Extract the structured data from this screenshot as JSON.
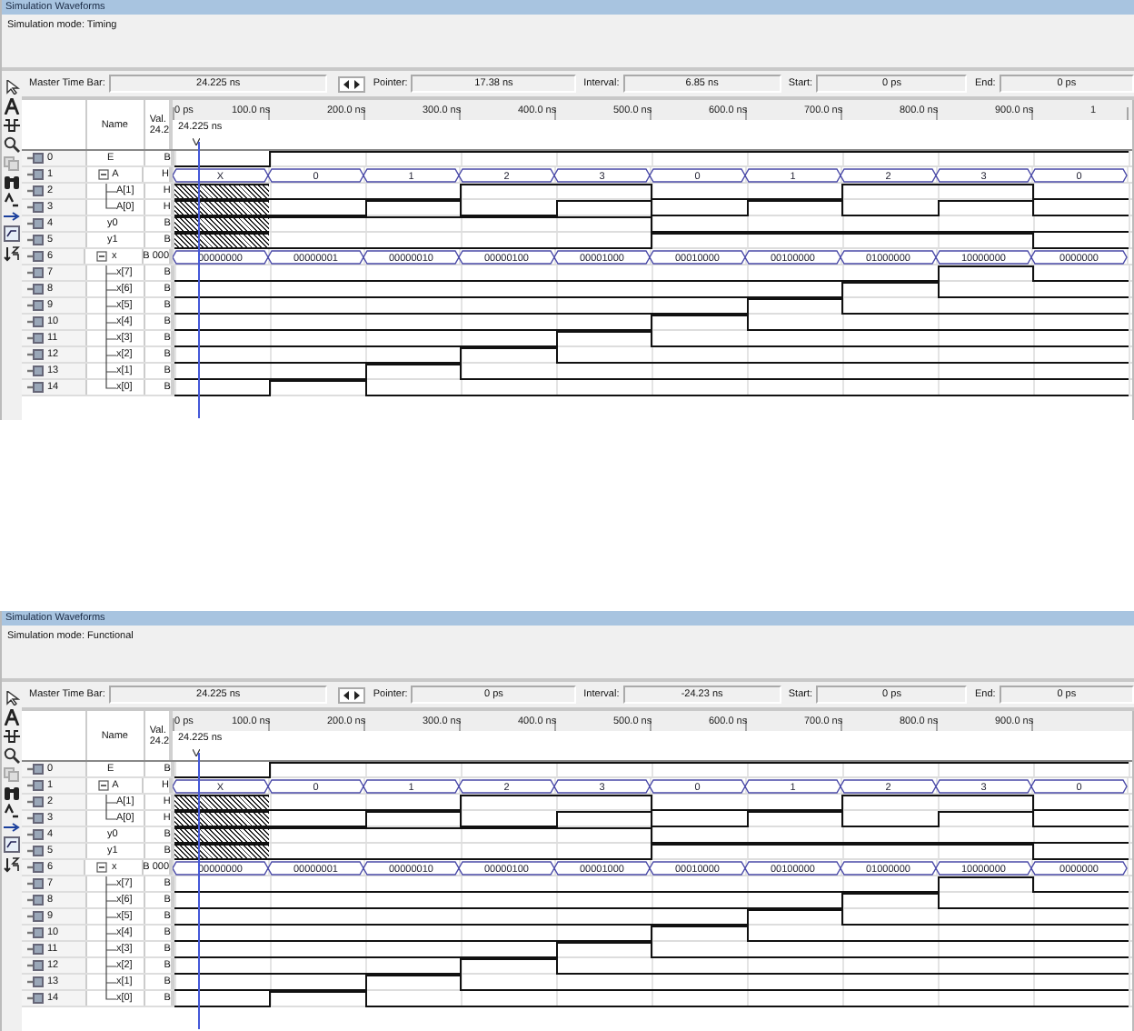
{
  "panels": [
    {
      "title": "Simulation Waveforms",
      "mode": "Simulation mode: Timing",
      "master_time_bar": {
        "label": "Master Time Bar:",
        "value": "24.225 ns"
      },
      "pointer": {
        "label": "Pointer:",
        "value": "17.38 ns"
      },
      "interval": {
        "label": "Interval:",
        "value": "6.85 ns"
      },
      "start": {
        "label": "Start:",
        "value": "0 ps"
      },
      "end": {
        "label": "End:",
        "value": "0 ps"
      },
      "name_header": "Name",
      "value_header": [
        "Val.",
        "24.2"
      ],
      "cursor_label": "24.225 ns",
      "ticks": [
        "0 ps",
        "100.0 ns",
        "200.0 ns",
        "300.0 ns",
        "400.0 ns",
        "500.0 ns",
        "600.0 ns",
        "700.0 ns",
        "800.0 ns",
        "900.0 ns",
        "1"
      ],
      "signals": [
        {
          "index": "0",
          "name": "E",
          "value": "B",
          "kind": "bit",
          "wave": [
            {
              "high": false,
              "unknown": false
            },
            {
              "high": true,
              "unknown": false
            },
            {
              "high": true,
              "unknown": false
            },
            {
              "high": true,
              "unknown": false
            },
            {
              "high": true,
              "unknown": false
            },
            {
              "high": true,
              "unknown": false
            },
            {
              "high": true,
              "unknown": false
            },
            {
              "high": true,
              "unknown": false
            },
            {
              "high": true,
              "unknown": false
            },
            {
              "high": true,
              "unknown": false
            }
          ]
        },
        {
          "index": "1",
          "name": "A",
          "value": "H",
          "kind": "bus",
          "expanded": true,
          "wave": [
            "X",
            "0",
            "1",
            "2",
            "3",
            "0",
            "1",
            "2",
            "3",
            "0"
          ],
          "children": [
            {
              "index": "2",
              "name": "A[1]",
              "value": "H",
              "kind": "bit",
              "wave": [
                {
                  "unknown": true
                },
                {
                  "high": false,
                  "unknown": false
                },
                {
                  "high": false,
                  "unknown": false
                },
                {
                  "high": true,
                  "unknown": false
                },
                {
                  "high": true,
                  "unknown": false
                },
                {
                  "high": false,
                  "unknown": false
                },
                {
                  "high": false,
                  "unknown": false
                },
                {
                  "high": true,
                  "unknown": false
                },
                {
                  "high": true,
                  "unknown": false
                },
                {
                  "high": false,
                  "unknown": false
                }
              ]
            },
            {
              "index": "3",
              "name": "A[0]",
              "value": "H",
              "kind": "bit",
              "wave": [
                {
                  "unknown": true
                },
                {
                  "high": false,
                  "unknown": false
                },
                {
                  "high": true,
                  "unknown": false
                },
                {
                  "high": false,
                  "unknown": false
                },
                {
                  "high": true,
                  "unknown": false
                },
                {
                  "high": false,
                  "unknown": false
                },
                {
                  "high": true,
                  "unknown": false
                },
                {
                  "high": false,
                  "unknown": false
                },
                {
                  "high": true,
                  "unknown": false
                },
                {
                  "high": false,
                  "unknown": false
                }
              ]
            }
          ]
        },
        {
          "index": "4",
          "name": "y0",
          "value": "B",
          "kind": "bit",
          "wave": [
            {
              "unknown": true
            },
            {
              "high": true,
              "unknown": false
            },
            {
              "high": true,
              "unknown": false
            },
            {
              "high": true,
              "unknown": false
            },
            {
              "high": true,
              "unknown": false
            },
            {
              "high": false,
              "unknown": false
            },
            {
              "high": false,
              "unknown": false
            },
            {
              "high": false,
              "unknown": false
            },
            {
              "high": false,
              "unknown": false
            },
            {
              "high": false,
              "unknown": false
            }
          ]
        },
        {
          "index": "5",
          "name": "y1",
          "value": "B",
          "kind": "bit",
          "wave": [
            {
              "unknown": true
            },
            {
              "high": false,
              "unknown": false
            },
            {
              "high": false,
              "unknown": false
            },
            {
              "high": false,
              "unknown": false
            },
            {
              "high": false,
              "unknown": false
            },
            {
              "high": true,
              "unknown": false
            },
            {
              "high": true,
              "unknown": false
            },
            {
              "high": true,
              "unknown": false
            },
            {
              "high": true,
              "unknown": false
            },
            {
              "high": false,
              "unknown": false
            }
          ]
        },
        {
          "index": "6",
          "name": "x",
          "value": "B 000",
          "kind": "bus",
          "expanded": true,
          "wave": [
            "00000000",
            "00000001",
            "00000010",
            "00000100",
            "00001000",
            "00010000",
            "00100000",
            "01000000",
            "10000000",
            "0000000"
          ],
          "children": [
            {
              "index": "7",
              "name": "x[7]",
              "value": "B",
              "kind": "bit",
              "wave": [
                {
                  "high": false,
                  "unknown": false
                },
                {
                  "high": false,
                  "unknown": false
                },
                {
                  "high": false,
                  "unknown": false
                },
                {
                  "high": false,
                  "unknown": false
                },
                {
                  "high": false,
                  "unknown": false
                },
                {
                  "high": false,
                  "unknown": false
                },
                {
                  "high": false,
                  "unknown": false
                },
                {
                  "high": false,
                  "unknown": false
                },
                {
                  "high": true,
                  "unknown": false
                },
                {
                  "high": false,
                  "unknown": false
                }
              ]
            },
            {
              "index": "8",
              "name": "x[6]",
              "value": "B",
              "kind": "bit",
              "wave": [
                {
                  "high": false,
                  "unknown": false
                },
                {
                  "high": false,
                  "unknown": false
                },
                {
                  "high": false,
                  "unknown": false
                },
                {
                  "high": false,
                  "unknown": false
                },
                {
                  "high": false,
                  "unknown": false
                },
                {
                  "high": false,
                  "unknown": false
                },
                {
                  "high": false,
                  "unknown": false
                },
                {
                  "high": true,
                  "unknown": false
                },
                {
                  "high": false,
                  "unknown": false
                },
                {
                  "high": false,
                  "unknown": false
                }
              ]
            },
            {
              "index": "9",
              "name": "x[5]",
              "value": "B",
              "kind": "bit",
              "wave": [
                {
                  "high": false,
                  "unknown": false
                },
                {
                  "high": false,
                  "unknown": false
                },
                {
                  "high": false,
                  "unknown": false
                },
                {
                  "high": false,
                  "unknown": false
                },
                {
                  "high": false,
                  "unknown": false
                },
                {
                  "high": false,
                  "unknown": false
                },
                {
                  "high": true,
                  "unknown": false
                },
                {
                  "high": false,
                  "unknown": false
                },
                {
                  "high": false,
                  "unknown": false
                },
                {
                  "high": false,
                  "unknown": false
                }
              ]
            },
            {
              "index": "10",
              "name": "x[4]",
              "value": "B",
              "kind": "bit",
              "wave": [
                {
                  "high": false,
                  "unknown": false
                },
                {
                  "high": false,
                  "unknown": false
                },
                {
                  "high": false,
                  "unknown": false
                },
                {
                  "high": false,
                  "unknown": false
                },
                {
                  "high": false,
                  "unknown": false
                },
                {
                  "high": true,
                  "unknown": false
                },
                {
                  "high": false,
                  "unknown": false
                },
                {
                  "high": false,
                  "unknown": false
                },
                {
                  "high": false,
                  "unknown": false
                },
                {
                  "high": false,
                  "unknown": false
                }
              ]
            },
            {
              "index": "11",
              "name": "x[3]",
              "value": "B",
              "kind": "bit",
              "wave": [
                {
                  "high": false,
                  "unknown": false
                },
                {
                  "high": false,
                  "unknown": false
                },
                {
                  "high": false,
                  "unknown": false
                },
                {
                  "high": false,
                  "unknown": false
                },
                {
                  "high": true,
                  "unknown": false
                },
                {
                  "high": false,
                  "unknown": false
                },
                {
                  "high": false,
                  "unknown": false
                },
                {
                  "high": false,
                  "unknown": false
                },
                {
                  "high": false,
                  "unknown": false
                },
                {
                  "high": false,
                  "unknown": false
                }
              ]
            },
            {
              "index": "12",
              "name": "x[2]",
              "value": "B",
              "kind": "bit",
              "wave": [
                {
                  "high": false,
                  "unknown": false
                },
                {
                  "high": false,
                  "unknown": false
                },
                {
                  "high": false,
                  "unknown": false
                },
                {
                  "high": true,
                  "unknown": false
                },
                {
                  "high": false,
                  "unknown": false
                },
                {
                  "high": false,
                  "unknown": false
                },
                {
                  "high": false,
                  "unknown": false
                },
                {
                  "high": false,
                  "unknown": false
                },
                {
                  "high": false,
                  "unknown": false
                },
                {
                  "high": false,
                  "unknown": false
                }
              ]
            },
            {
              "index": "13",
              "name": "x[1]",
              "value": "B",
              "kind": "bit",
              "wave": [
                {
                  "high": false,
                  "unknown": false
                },
                {
                  "high": false,
                  "unknown": false
                },
                {
                  "high": true,
                  "unknown": false
                },
                {
                  "high": false,
                  "unknown": false
                },
                {
                  "high": false,
                  "unknown": false
                },
                {
                  "high": false,
                  "unknown": false
                },
                {
                  "high": false,
                  "unknown": false
                },
                {
                  "high": false,
                  "unknown": false
                },
                {
                  "high": false,
                  "unknown": false
                },
                {
                  "high": false,
                  "unknown": false
                }
              ]
            },
            {
              "index": "14",
              "name": "x[0]",
              "value": "B",
              "kind": "bit",
              "wave": [
                {
                  "high": false,
                  "unknown": false
                },
                {
                  "high": true,
                  "unknown": false
                },
                {
                  "high": false,
                  "unknown": false
                },
                {
                  "high": false,
                  "unknown": false
                },
                {
                  "high": false,
                  "unknown": false
                },
                {
                  "high": false,
                  "unknown": false
                },
                {
                  "high": false,
                  "unknown": false
                },
                {
                  "high": false,
                  "unknown": false
                },
                {
                  "high": false,
                  "unknown": false
                },
                {
                  "high": false,
                  "unknown": false
                }
              ]
            }
          ]
        }
      ]
    },
    {
      "title": "Simulation Waveforms",
      "mode": "Simulation mode: Functional",
      "master_time_bar": {
        "label": "Master Time Bar:",
        "value": "24.225 ns"
      },
      "pointer": {
        "label": "Pointer:",
        "value": "0 ps"
      },
      "interval": {
        "label": "Interval:",
        "value": "-24.23 ns"
      },
      "start": {
        "label": "Start:",
        "value": "0 ps"
      },
      "end": {
        "label": "End:",
        "value": "0 ps"
      },
      "name_header": "Name",
      "value_header": [
        "Val.",
        "24.2"
      ],
      "cursor_label": "24.225 ns",
      "ticks": [
        "0 ps",
        "100.0 ns",
        "200.0 ns",
        "300.0 ns",
        "400.0 ns",
        "500.0 ns",
        "600.0 ns",
        "700.0 ns",
        "800.0 ns",
        "900.0 ns"
      ],
      "signals": [
        {
          "index": "0",
          "name": "E",
          "value": "B",
          "kind": "bit",
          "wave": [
            {
              "high": false,
              "unknown": false
            },
            {
              "high": true,
              "unknown": false
            },
            {
              "high": true,
              "unknown": false
            },
            {
              "high": true,
              "unknown": false
            },
            {
              "high": true,
              "unknown": false
            },
            {
              "high": true,
              "unknown": false
            },
            {
              "high": true,
              "unknown": false
            },
            {
              "high": true,
              "unknown": false
            },
            {
              "high": true,
              "unknown": false
            },
            {
              "high": true,
              "unknown": false
            }
          ]
        },
        {
          "index": "1",
          "name": "A",
          "value": "H",
          "kind": "bus",
          "expanded": true,
          "wave": [
            "X",
            "0",
            "1",
            "2",
            "3",
            "0",
            "1",
            "2",
            "3",
            "0"
          ],
          "children": [
            {
              "index": "2",
              "name": "A[1]",
              "value": "H",
              "kind": "bit",
              "wave": [
                {
                  "unknown": true
                },
                {
                  "high": false,
                  "unknown": false
                },
                {
                  "high": false,
                  "unknown": false
                },
                {
                  "high": true,
                  "unknown": false
                },
                {
                  "high": true,
                  "unknown": false
                },
                {
                  "high": false,
                  "unknown": false
                },
                {
                  "high": false,
                  "unknown": false
                },
                {
                  "high": true,
                  "unknown": false
                },
                {
                  "high": true,
                  "unknown": false
                },
                {
                  "high": false,
                  "unknown": false
                }
              ]
            },
            {
              "index": "3",
              "name": "A[0]",
              "value": "H",
              "kind": "bit",
              "wave": [
                {
                  "unknown": true
                },
                {
                  "high": false,
                  "unknown": false
                },
                {
                  "high": true,
                  "unknown": false
                },
                {
                  "high": false,
                  "unknown": false
                },
                {
                  "high": true,
                  "unknown": false
                },
                {
                  "high": false,
                  "unknown": false
                },
                {
                  "high": true,
                  "unknown": false
                },
                {
                  "high": false,
                  "unknown": false
                },
                {
                  "high": true,
                  "unknown": false
                },
                {
                  "high": false,
                  "unknown": false
                }
              ]
            }
          ]
        },
        {
          "index": "4",
          "name": "y0",
          "value": "B",
          "kind": "bit",
          "wave": [
            {
              "unknown": true
            },
            {
              "high": true,
              "unknown": false
            },
            {
              "high": true,
              "unknown": false
            },
            {
              "high": true,
              "unknown": false
            },
            {
              "high": true,
              "unknown": false
            },
            {
              "high": false,
              "unknown": false
            },
            {
              "high": false,
              "unknown": false
            },
            {
              "high": false,
              "unknown": false
            },
            {
              "high": false,
              "unknown": false
            },
            {
              "high": false,
              "unknown": false
            }
          ]
        },
        {
          "index": "5",
          "name": "y1",
          "value": "B",
          "kind": "bit",
          "wave": [
            {
              "unknown": true
            },
            {
              "high": false,
              "unknown": false
            },
            {
              "high": false,
              "unknown": false
            },
            {
              "high": false,
              "unknown": false
            },
            {
              "high": false,
              "unknown": false
            },
            {
              "high": true,
              "unknown": false
            },
            {
              "high": true,
              "unknown": false
            },
            {
              "high": true,
              "unknown": false
            },
            {
              "high": true,
              "unknown": false
            },
            {
              "high": false,
              "unknown": false
            }
          ]
        },
        {
          "index": "6",
          "name": "x",
          "value": "B 000",
          "kind": "bus",
          "expanded": true,
          "wave": [
            "00000000",
            "00000001",
            "00000010",
            "00000100",
            "00001000",
            "00010000",
            "00100000",
            "01000000",
            "10000000",
            "0000000"
          ],
          "children": [
            {
              "index": "7",
              "name": "x[7]",
              "value": "B",
              "kind": "bit",
              "wave": [
                {
                  "high": false,
                  "unknown": false
                },
                {
                  "high": false,
                  "unknown": false
                },
                {
                  "high": false,
                  "unknown": false
                },
                {
                  "high": false,
                  "unknown": false
                },
                {
                  "high": false,
                  "unknown": false
                },
                {
                  "high": false,
                  "unknown": false
                },
                {
                  "high": false,
                  "unknown": false
                },
                {
                  "high": false,
                  "unknown": false
                },
                {
                  "high": true,
                  "unknown": false
                },
                {
                  "high": false,
                  "unknown": false
                }
              ]
            },
            {
              "index": "8",
              "name": "x[6]",
              "value": "B",
              "kind": "bit",
              "wave": [
                {
                  "high": false,
                  "unknown": false
                },
                {
                  "high": false,
                  "unknown": false
                },
                {
                  "high": false,
                  "unknown": false
                },
                {
                  "high": false,
                  "unknown": false
                },
                {
                  "high": false,
                  "unknown": false
                },
                {
                  "high": false,
                  "unknown": false
                },
                {
                  "high": false,
                  "unknown": false
                },
                {
                  "high": true,
                  "unknown": false
                },
                {
                  "high": false,
                  "unknown": false
                },
                {
                  "high": false,
                  "unknown": false
                }
              ]
            },
            {
              "index": "9",
              "name": "x[5]",
              "value": "B",
              "kind": "bit",
              "wave": [
                {
                  "high": false,
                  "unknown": false
                },
                {
                  "high": false,
                  "unknown": false
                },
                {
                  "high": false,
                  "unknown": false
                },
                {
                  "high": false,
                  "unknown": false
                },
                {
                  "high": false,
                  "unknown": false
                },
                {
                  "high": false,
                  "unknown": false
                },
                {
                  "high": true,
                  "unknown": false
                },
                {
                  "high": false,
                  "unknown": false
                },
                {
                  "high": false,
                  "unknown": false
                },
                {
                  "high": false,
                  "unknown": false
                }
              ]
            },
            {
              "index": "10",
              "name": "x[4]",
              "value": "B",
              "kind": "bit",
              "wave": [
                {
                  "high": false,
                  "unknown": false
                },
                {
                  "high": false,
                  "unknown": false
                },
                {
                  "high": false,
                  "unknown": false
                },
                {
                  "high": false,
                  "unknown": false
                },
                {
                  "high": false,
                  "unknown": false
                },
                {
                  "high": true,
                  "unknown": false
                },
                {
                  "high": false,
                  "unknown": false
                },
                {
                  "high": false,
                  "unknown": false
                },
                {
                  "high": false,
                  "unknown": false
                },
                {
                  "high": false,
                  "unknown": false
                }
              ]
            },
            {
              "index": "11",
              "name": "x[3]",
              "value": "B",
              "kind": "bit",
              "wave": [
                {
                  "high": false,
                  "unknown": false
                },
                {
                  "high": false,
                  "unknown": false
                },
                {
                  "high": false,
                  "unknown": false
                },
                {
                  "high": false,
                  "unknown": false
                },
                {
                  "high": true,
                  "unknown": false
                },
                {
                  "high": false,
                  "unknown": false
                },
                {
                  "high": false,
                  "unknown": false
                },
                {
                  "high": false,
                  "unknown": false
                },
                {
                  "high": false,
                  "unknown": false
                },
                {
                  "high": false,
                  "unknown": false
                }
              ]
            },
            {
              "index": "12",
              "name": "x[2]",
              "value": "B",
              "kind": "bit",
              "wave": [
                {
                  "high": false,
                  "unknown": false
                },
                {
                  "high": false,
                  "unknown": false
                },
                {
                  "high": false,
                  "unknown": false
                },
                {
                  "high": true,
                  "unknown": false
                },
                {
                  "high": false,
                  "unknown": false
                },
                {
                  "high": false,
                  "unknown": false
                },
                {
                  "high": false,
                  "unknown": false
                },
                {
                  "high": false,
                  "unknown": false
                },
                {
                  "high": false,
                  "unknown": false
                },
                {
                  "high": false,
                  "unknown": false
                }
              ]
            },
            {
              "index": "13",
              "name": "x[1]",
              "value": "B",
              "kind": "bit",
              "wave": [
                {
                  "high": false,
                  "unknown": false
                },
                {
                  "high": false,
                  "unknown": false
                },
                {
                  "high": true,
                  "unknown": false
                },
                {
                  "high": false,
                  "unknown": false
                },
                {
                  "high": false,
                  "unknown": false
                },
                {
                  "high": false,
                  "unknown": false
                },
                {
                  "high": false,
                  "unknown": false
                },
                {
                  "high": false,
                  "unknown": false
                },
                {
                  "high": false,
                  "unknown": false
                },
                {
                  "high": false,
                  "unknown": false
                }
              ]
            },
            {
              "index": "14",
              "name": "x[0]",
              "value": "B",
              "kind": "bit",
              "wave": [
                {
                  "high": false,
                  "unknown": false
                },
                {
                  "high": true,
                  "unknown": false
                },
                {
                  "high": false,
                  "unknown": false
                },
                {
                  "high": false,
                  "unknown": false
                },
                {
                  "high": false,
                  "unknown": false
                },
                {
                  "high": false,
                  "unknown": false
                },
                {
                  "high": false,
                  "unknown": false
                },
                {
                  "high": false,
                  "unknown": false
                },
                {
                  "high": false,
                  "unknown": false
                },
                {
                  "high": false,
                  "unknown": false
                }
              ]
            }
          ]
        }
      ]
    }
  ]
}
